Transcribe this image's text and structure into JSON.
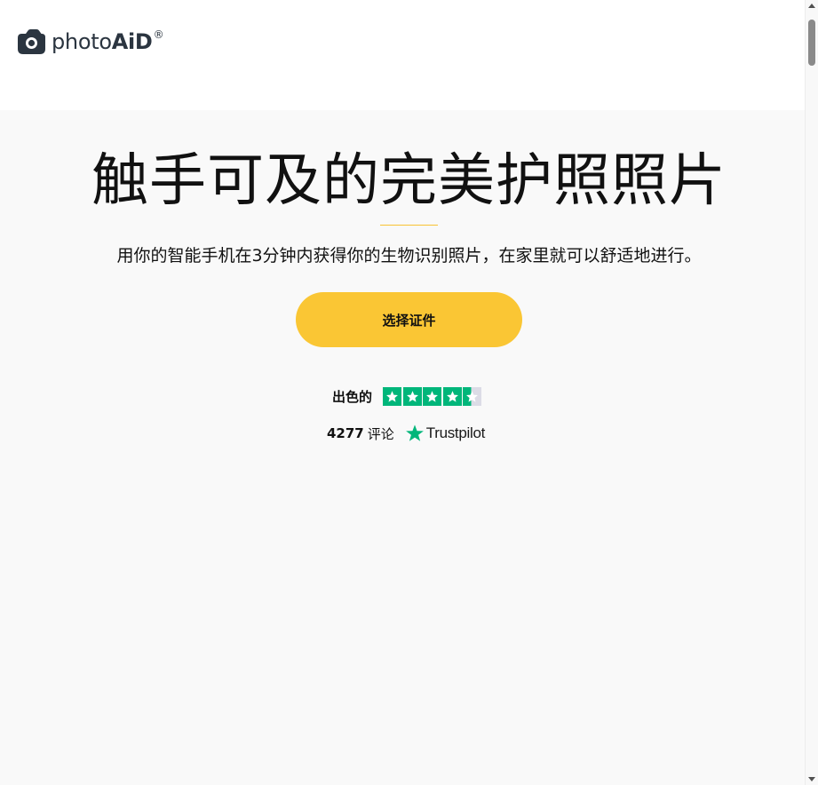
{
  "header": {
    "logo": {
      "icon": "camera-icon",
      "text_light": "photo",
      "text_bold": "AiD",
      "registered": "®",
      "color": "#2b3540"
    }
  },
  "hero": {
    "title": "触手可及的完美护照照片",
    "subtitle": "用你的智能手机在3分钟内获得你的生物识别照片，在家里就可以舒适地进行。",
    "cta_label": "选择证件",
    "divider_color": "#f8c334",
    "cta_color": "#fac634",
    "background": "#f9f9f9"
  },
  "rating": {
    "label": "出色的",
    "stars": 4.5,
    "star_icon": "trustpilot-star-icon",
    "star_color": "#00b67a",
    "review_count": "4277",
    "review_word": "评论",
    "provider": "Trustpilot"
  }
}
